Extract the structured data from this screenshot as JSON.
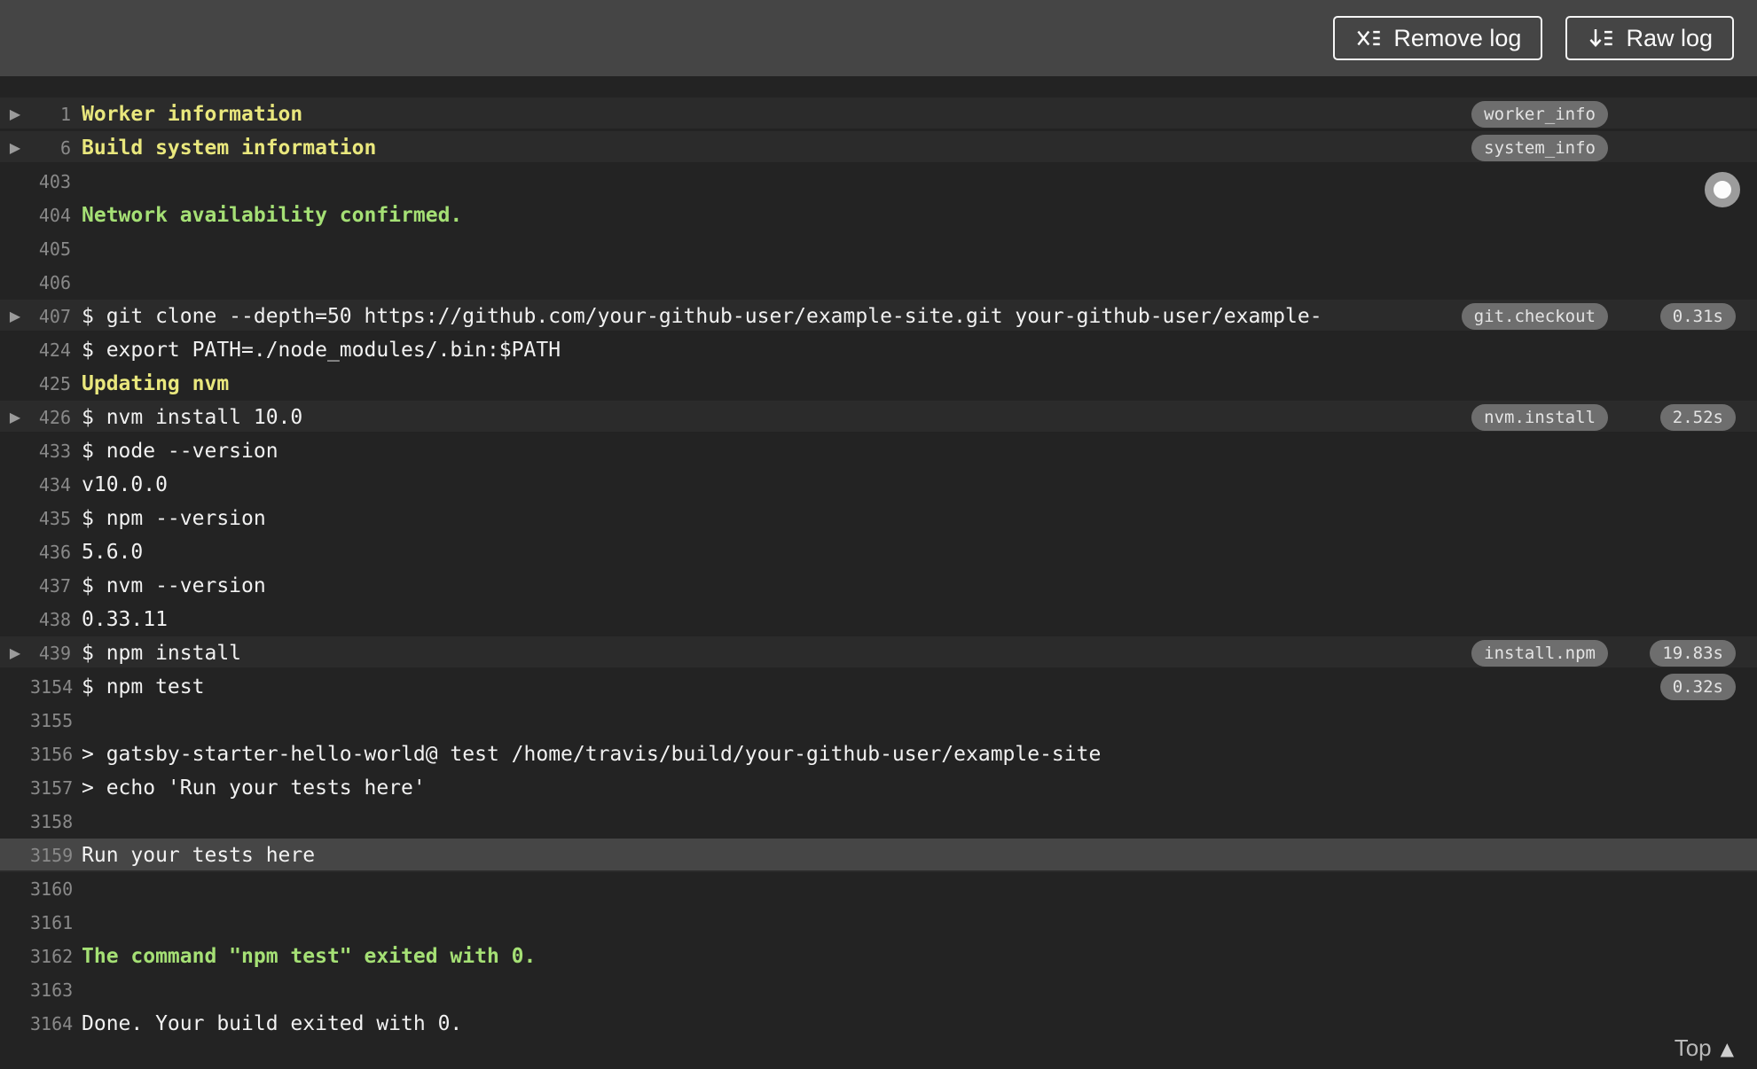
{
  "header": {
    "remove_log_label": "Remove log",
    "raw_log_label": "Raw log"
  },
  "log": {
    "top_link_label": "Top",
    "rows": [
      {
        "num": "1",
        "text": "Worker information",
        "style": "yellow",
        "fold": true,
        "badge": "worker_info",
        "duration": null
      },
      {
        "num": "6",
        "text": "Build system information",
        "style": "yellow",
        "fold": true,
        "badge": "system_info",
        "duration": null
      },
      {
        "num": "403",
        "text": "",
        "style": "default",
        "fold": false,
        "badge": null,
        "duration": null
      },
      {
        "num": "404",
        "text": "Network availability confirmed.",
        "style": "green",
        "fold": false,
        "badge": null,
        "duration": null
      },
      {
        "num": "405",
        "text": "",
        "style": "default",
        "fold": false,
        "badge": null,
        "duration": null
      },
      {
        "num": "406",
        "text": "",
        "style": "default",
        "fold": false,
        "badge": null,
        "duration": null
      },
      {
        "num": "407",
        "text": "$ git clone --depth=50 https://github.com/your-github-user/example-site.git your-github-user/example-",
        "style": "default",
        "fold": true,
        "badge": "git.checkout",
        "duration": "0.31s"
      },
      {
        "num": "424",
        "text": "$ export PATH=./node_modules/.bin:$PATH",
        "style": "default",
        "fold": false,
        "badge": null,
        "duration": null
      },
      {
        "num": "425",
        "text": "Updating nvm",
        "style": "yellow",
        "fold": false,
        "badge": null,
        "duration": null
      },
      {
        "num": "426",
        "text": "$ nvm install 10.0",
        "style": "default",
        "fold": true,
        "badge": "nvm.install",
        "duration": "2.52s"
      },
      {
        "num": "433",
        "text": "$ node --version",
        "style": "default",
        "fold": false,
        "badge": null,
        "duration": null
      },
      {
        "num": "434",
        "text": "v10.0.0",
        "style": "default",
        "fold": false,
        "badge": null,
        "duration": null
      },
      {
        "num": "435",
        "text": "$ npm --version",
        "style": "default",
        "fold": false,
        "badge": null,
        "duration": null
      },
      {
        "num": "436",
        "text": "5.6.0",
        "style": "default",
        "fold": false,
        "badge": null,
        "duration": null
      },
      {
        "num": "437",
        "text": "$ nvm --version",
        "style": "default",
        "fold": false,
        "badge": null,
        "duration": null
      },
      {
        "num": "438",
        "text": "0.33.11",
        "style": "default",
        "fold": false,
        "badge": null,
        "duration": null
      },
      {
        "num": "439",
        "text": "$ npm install",
        "style": "default",
        "fold": true,
        "badge": "install.npm",
        "duration": "19.83s"
      },
      {
        "num": "3154",
        "text": "$ npm test",
        "style": "default",
        "fold": false,
        "badge": null,
        "duration": "0.32s"
      },
      {
        "num": "3155",
        "text": "",
        "style": "default",
        "fold": false,
        "badge": null,
        "duration": null
      },
      {
        "num": "3156",
        "text": "> gatsby-starter-hello-world@ test /home/travis/build/your-github-user/example-site",
        "style": "default",
        "fold": false,
        "badge": null,
        "duration": null
      },
      {
        "num": "3157",
        "text": "> echo 'Run your tests here'",
        "style": "default",
        "fold": false,
        "badge": null,
        "duration": null
      },
      {
        "num": "3158",
        "text": "",
        "style": "default",
        "fold": false,
        "badge": null,
        "duration": null
      },
      {
        "num": "3159",
        "text": "Run your tests here",
        "style": "default",
        "fold": false,
        "selected": true,
        "badge": null,
        "duration": null
      },
      {
        "num": "3160",
        "text": "",
        "style": "default",
        "fold": false,
        "badge": null,
        "duration": null
      },
      {
        "num": "3161",
        "text": "",
        "style": "default",
        "fold": false,
        "badge": null,
        "duration": null
      },
      {
        "num": "3162",
        "text": "The command \"npm test\" exited with 0.",
        "style": "green",
        "fold": false,
        "badge": null,
        "duration": null
      },
      {
        "num": "3163",
        "text": "",
        "style": "default",
        "fold": false,
        "badge": null,
        "duration": null
      },
      {
        "num": "3164",
        "text": "Done. Your build exited with 0.",
        "style": "default",
        "fold": false,
        "badge": null,
        "duration": null
      }
    ]
  },
  "colors": {
    "header_bg": "#454545",
    "log_bg": "#232323",
    "fold_row_bg": "#2b2b2b",
    "selected_row_bg": "#464646",
    "text": "#f1f1f1",
    "yellow": "#e9e77d",
    "green": "#a5e075",
    "badge_bg": "#6e6e6e",
    "line_number": "#898989"
  }
}
